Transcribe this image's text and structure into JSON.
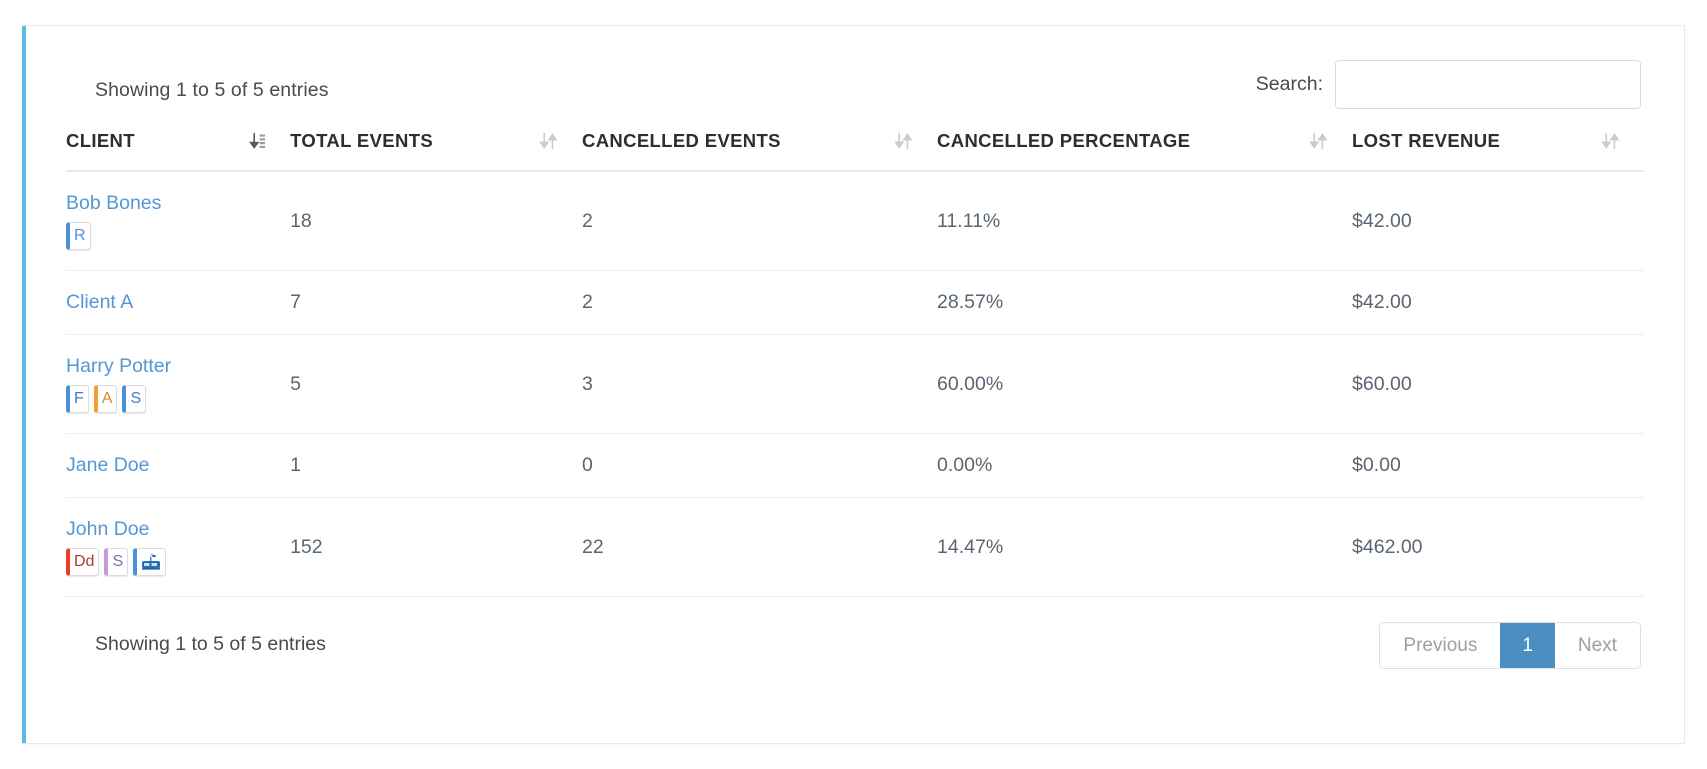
{
  "colors": {
    "accent_bar": "#5db8e8",
    "link": "#5497d4",
    "pagination_active_bg": "#4a8ec2",
    "text": "#5a6573",
    "header_text": "#2e2e2e"
  },
  "panel": {
    "info_top": "Showing 1 to 5 of 5 entries",
    "info_bottom": "Showing 1 to 5 of 5 entries"
  },
  "search": {
    "label": "Search:",
    "value": "",
    "placeholder": ""
  },
  "table": {
    "columns": [
      {
        "label": "CLIENT",
        "sort_icon": "sort-asc-icon",
        "sorted": true
      },
      {
        "label": "TOTAL EVENTS",
        "sort_icon": "sort-both-icon",
        "sorted": false
      },
      {
        "label": "CANCELLED EVENTS",
        "sort_icon": "sort-both-icon",
        "sorted": false
      },
      {
        "label": "CANCELLED PERCENTAGE",
        "sort_icon": "sort-both-icon",
        "sorted": false
      },
      {
        "label": "LOST REVENUE",
        "sort_icon": "sort-both-icon",
        "sorted": false
      }
    ],
    "rows": [
      {
        "client": "Bob Bones",
        "badges": [
          {
            "text": "R",
            "accent": "#4a90d9",
            "color": "#4a90d9",
            "icon": null
          }
        ],
        "total_events": "18",
        "cancelled_events": "2",
        "cancelled_percentage": "11.11%",
        "lost_revenue": "$42.00"
      },
      {
        "client": "Client A",
        "badges": [],
        "total_events": "7",
        "cancelled_events": "2",
        "cancelled_percentage": "28.57%",
        "lost_revenue": "$42.00"
      },
      {
        "client": "Harry Potter",
        "badges": [
          {
            "text": "F",
            "accent": "#4a90d9",
            "color": "#3d7fc1",
            "icon": null
          },
          {
            "text": "A",
            "accent": "#f0a22e",
            "color": "#d2892a",
            "icon": null
          },
          {
            "text": "S",
            "accent": "#4a90d9",
            "color": "#3d7fc1",
            "icon": null
          }
        ],
        "total_events": "5",
        "cancelled_events": "3",
        "cancelled_percentage": "60.00%",
        "lost_revenue": "$60.00"
      },
      {
        "client": "Jane Doe",
        "badges": [],
        "total_events": "1",
        "cancelled_events": "0",
        "cancelled_percentage": "0.00%",
        "lost_revenue": "$0.00"
      },
      {
        "client": "John Doe",
        "badges": [
          {
            "text": "Dd",
            "accent": "#e8402a",
            "color": "#a83c3c",
            "icon": null
          },
          {
            "text": "S",
            "accent": "#c49bd8",
            "color": "#8a6aa0",
            "icon": null
          },
          {
            "text": "",
            "accent": "#4a90d9",
            "color": "#1f5d9e",
            "icon": "mailbox-icon"
          }
        ],
        "total_events": "152",
        "cancelled_events": "22",
        "cancelled_percentage": "14.47%",
        "lost_revenue": "$462.00"
      }
    ]
  },
  "pagination": {
    "previous": "Previous",
    "pages": [
      "1"
    ],
    "next": "Next",
    "current": "1"
  }
}
